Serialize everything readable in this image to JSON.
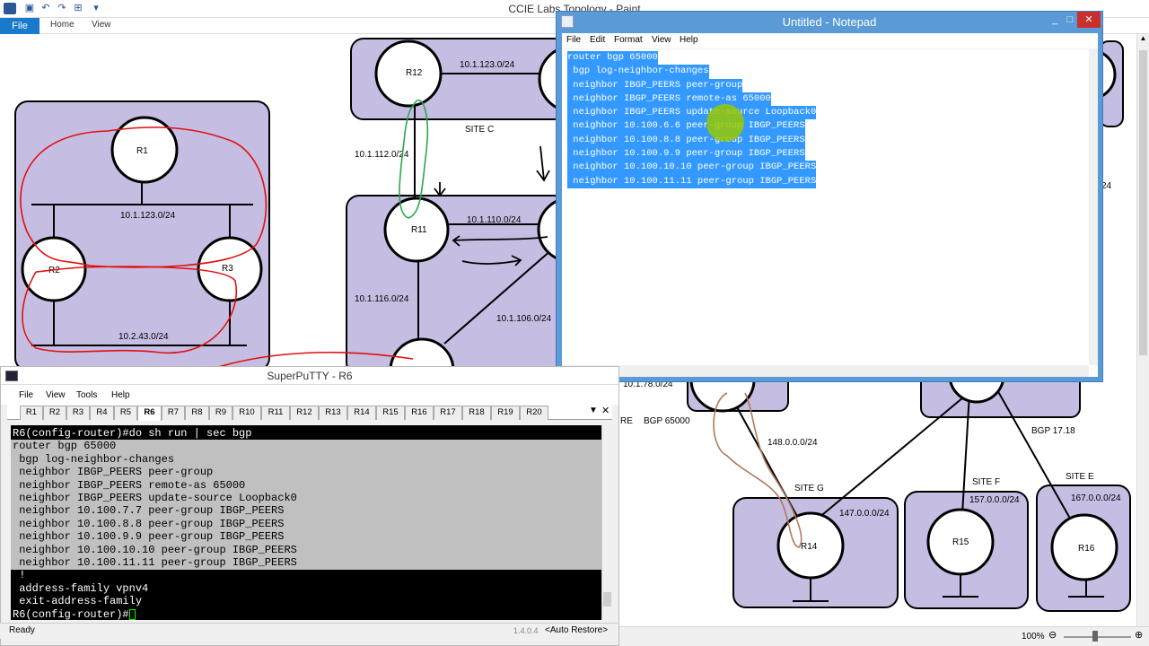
{
  "paint": {
    "title": "CCIE Labs Topology - Paint",
    "ribbon": {
      "file": "File",
      "home": "Home",
      "view": "View"
    },
    "status": {
      "zoom": "100%"
    }
  },
  "diagram": {
    "routers": [
      "R1",
      "R2",
      "R3",
      "R12",
      "R11",
      "R14",
      "R15",
      "R16"
    ],
    "networks": {
      "n1": "10.1.123.0/24",
      "n2": "10.2.43.0/24",
      "n3": "10.1.123.0/24",
      "n4": "10.1.112.0/24",
      "n5": "10.1.110.0/24",
      "n6": "10.1.116.0/24",
      "n7": "10.1.106.0/24",
      "n8": "10.1.78.0/24",
      "n9": "148.0.0.0/24",
      "n10": "147.0.0.0/24",
      "n11": "157.0.0.0/24",
      "n12": "167.0.0.0/24",
      "n13": "24"
    },
    "sites": {
      "c": "SITE C",
      "g": "SITE G",
      "f": "SITE F",
      "e": "SITE E"
    },
    "bgp": {
      "b1": "BGP 65000",
      "b2": "BGP 17.18",
      "re": "RE"
    }
  },
  "notepad": {
    "title": "Untitled - Notepad",
    "menu": [
      "File",
      "Edit",
      "Format",
      "View",
      "Help"
    ],
    "lines": [
      "router bgp 65000",
      " bgp log-neighbor-changes",
      " neighbor IBGP_PEERS peer-group",
      " neighbor IBGP_PEERS remote-as 65000",
      " neighbor IBGP_PEERS update-source Loopback0",
      " neighbor 10.100.6.6 peer-group IBGP_PEERS",
      " neighbor 10.100.8.8 peer-group IBGP_PEERS",
      " neighbor 10.100.9.9 peer-group IBGP_PEERS",
      " neighbor 10.100.10.10 peer-group IBGP_PEERS",
      " neighbor 10.100.11.11 peer-group IBGP_PEERS"
    ]
  },
  "putty": {
    "title": "SuperPuTTY - R6",
    "menu": [
      "File",
      "View",
      "Tools",
      "Help"
    ],
    "tabs": [
      "R1",
      "R2",
      "R3",
      "R4",
      "R5",
      "R6",
      "R7",
      "R8",
      "R9",
      "R10",
      "R11",
      "R12",
      "R13",
      "R14",
      "R15",
      "R16",
      "R17",
      "R18",
      "R19",
      "R20"
    ],
    "active_tab": "R6",
    "terminal": [
      "R6(config-router)#do sh run | sec bgp",
      "router bgp 65000",
      " bgp log-neighbor-changes",
      " neighbor IBGP_PEERS peer-group",
      " neighbor IBGP_PEERS remote-as 65000",
      " neighbor IBGP_PEERS update-source Loopback0",
      " neighbor 10.100.7.7 peer-group IBGP_PEERS",
      " neighbor 10.100.8.8 peer-group IBGP_PEERS",
      " neighbor 10.100.9.9 peer-group IBGP_PEERS",
      " neighbor 10.100.10.10 peer-group IBGP_PEERS",
      " neighbor 10.100.11.11 peer-group IBGP_PEERS",
      " !",
      " address-family vpnv4",
      " exit-address-family",
      "R6(config-router)#"
    ],
    "status": {
      "ready": "Ready",
      "version": "1.4.0.4",
      "auto_restore": "<Auto Restore>"
    }
  }
}
